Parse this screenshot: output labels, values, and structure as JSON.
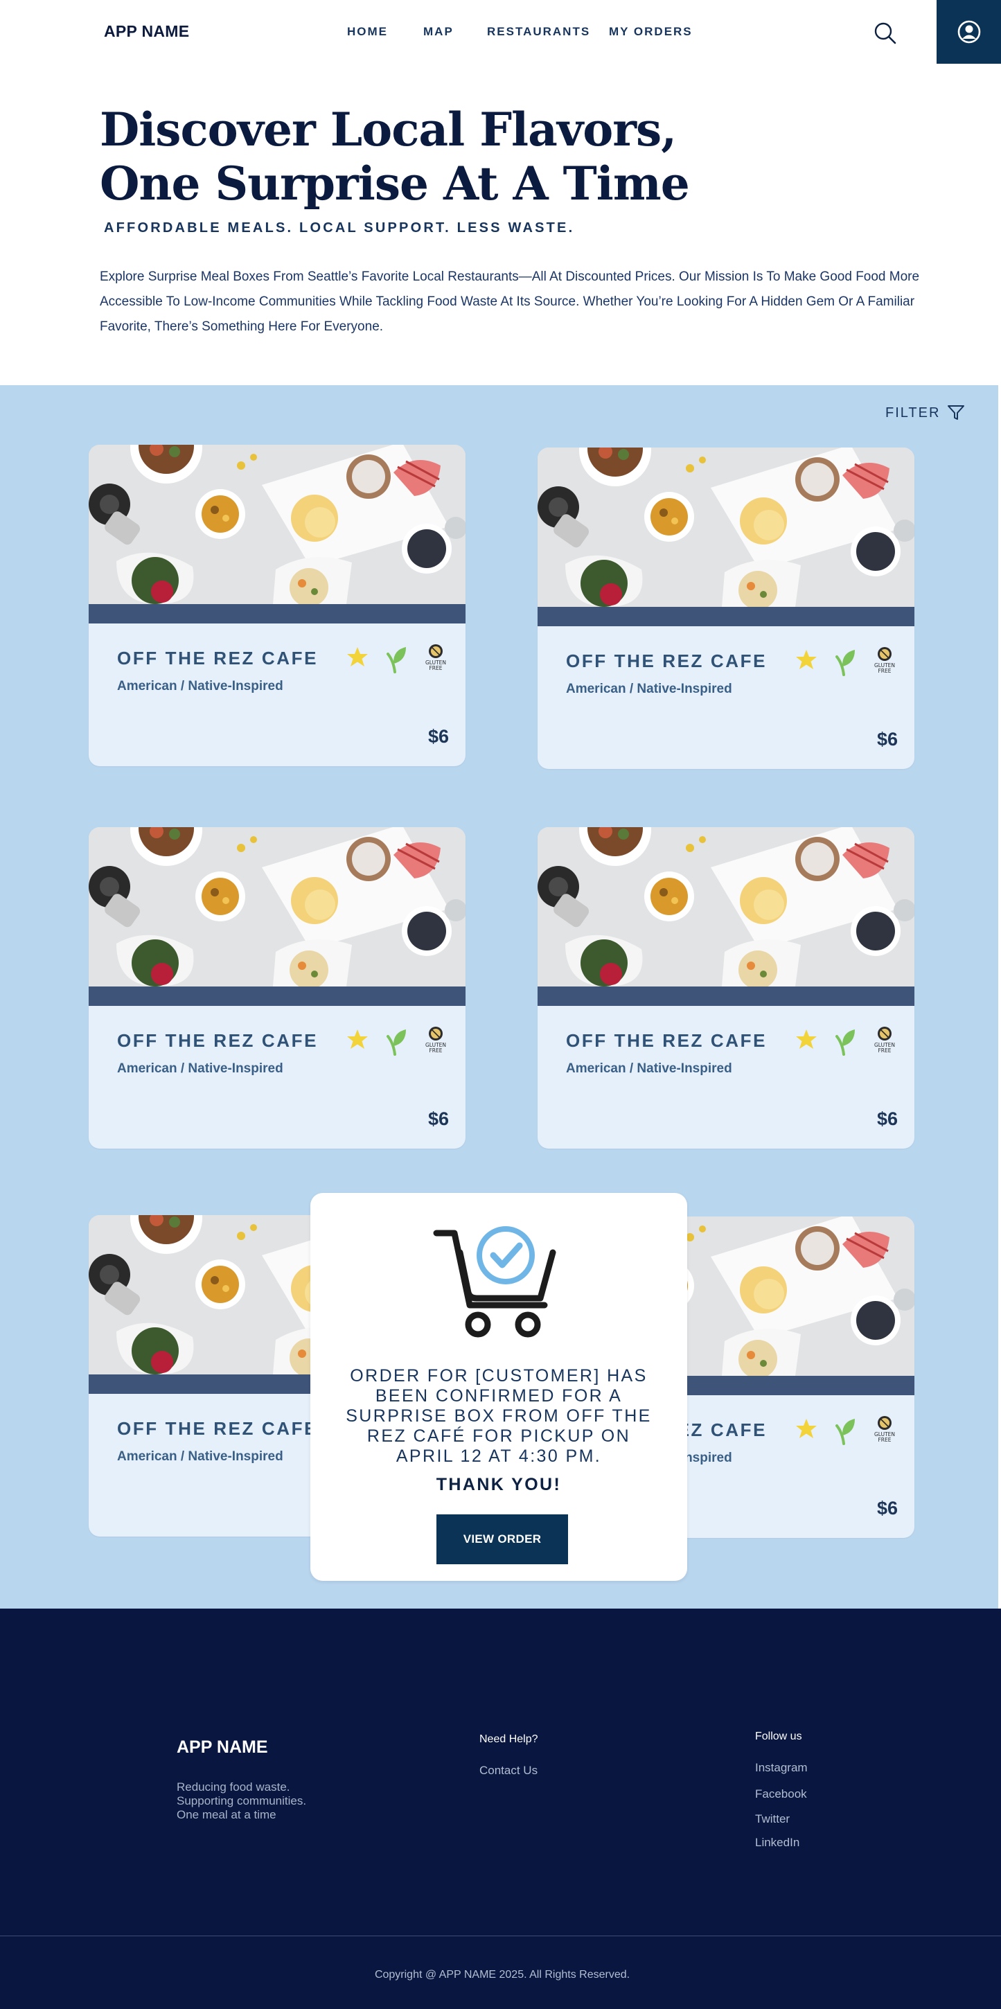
{
  "header": {
    "logo": "APP NAME",
    "nav": [
      "HOME",
      "MAP",
      "RESTAURANTS",
      "MY ORDERS"
    ],
    "icons": {
      "search": "search-icon",
      "account": "user-circle-icon"
    }
  },
  "hero": {
    "title_line1": "Discover Local Flavors,",
    "title_line2": "One Surprise At A Time",
    "subtitle": "AFFORDABLE MEALS. LOCAL SUPPORT. LESS WASTE.",
    "description": "Explore Surprise Meal Boxes From Seattle’s Favorite Local Restaurants—All At Discounted Prices. Our Mission Is To Make Good Food More Accessible To Low-Income Communities While Tackling Food Waste At Its Source. Whether You’re Looking For A Hidden Gem Or A Familiar Favorite, There’s Something Here For Everyone."
  },
  "filter": {
    "label": "FILTER",
    "icon": "filter-funnel-icon"
  },
  "cards": [
    {
      "name": "OFF THE REZ CAFE",
      "cuisine": "American / Native-Inspired",
      "price": "$6"
    },
    {
      "name": "OFF THE REZ CAFE",
      "cuisine": "American / Native-Inspired",
      "price": "$6"
    },
    {
      "name": "OFF THE REZ CAFE",
      "cuisine": "American / Native-Inspired",
      "price": "$6"
    },
    {
      "name": "OFF THE REZ CAFE",
      "cuisine": "American / Native-Inspired",
      "price": "$6"
    },
    {
      "name": "OFF THE REZ CAFE",
      "cuisine": "American / Native-Inspired",
      "price": "$6"
    },
    {
      "name": "OFF THE REZ CAFE",
      "cuisine": "American / Native-Inspired",
      "price": "$6"
    }
  ],
  "badges": {
    "star_icon": "star-icon",
    "vegan_icon": "leaf-icon",
    "gluten_free_label_line1": "GLUTEN",
    "gluten_free_label_line2": "FREE"
  },
  "modal": {
    "icon": "cart-check-icon",
    "message": "ORDER FOR [CUSTOMER] HAS BEEN CONFIRMED FOR A SURPRISE BOX FROM OFF THE REZ CAFÉ FOR PICKUP ON APRIL 12 AT 4:30 PM.",
    "thanks": "THANK YOU!",
    "button": "VIEW ORDER"
  },
  "footer": {
    "brand": "APP NAME",
    "tagline": [
      "Reducing food waste.",
      "Supporting communities.",
      "One meal at a time"
    ],
    "help_title": "Need Help?",
    "help_links": [
      "Contact Us"
    ],
    "follow_title": "Follow us",
    "follow_links": [
      "Instagram",
      "Facebook",
      "Twitter",
      "LinkedIn"
    ],
    "copyright": "Copyright @ APP NAME 2025. All Rights Reserved."
  },
  "colors": {
    "navy": "#0a3356",
    "footer_bg": "#081640",
    "section_bg": "#b9d6ef",
    "card_bg": "#e6f0fa",
    "star": "#f3d33a",
    "leaf": "#7cc25b",
    "cart_check": "#6fb6e6"
  }
}
